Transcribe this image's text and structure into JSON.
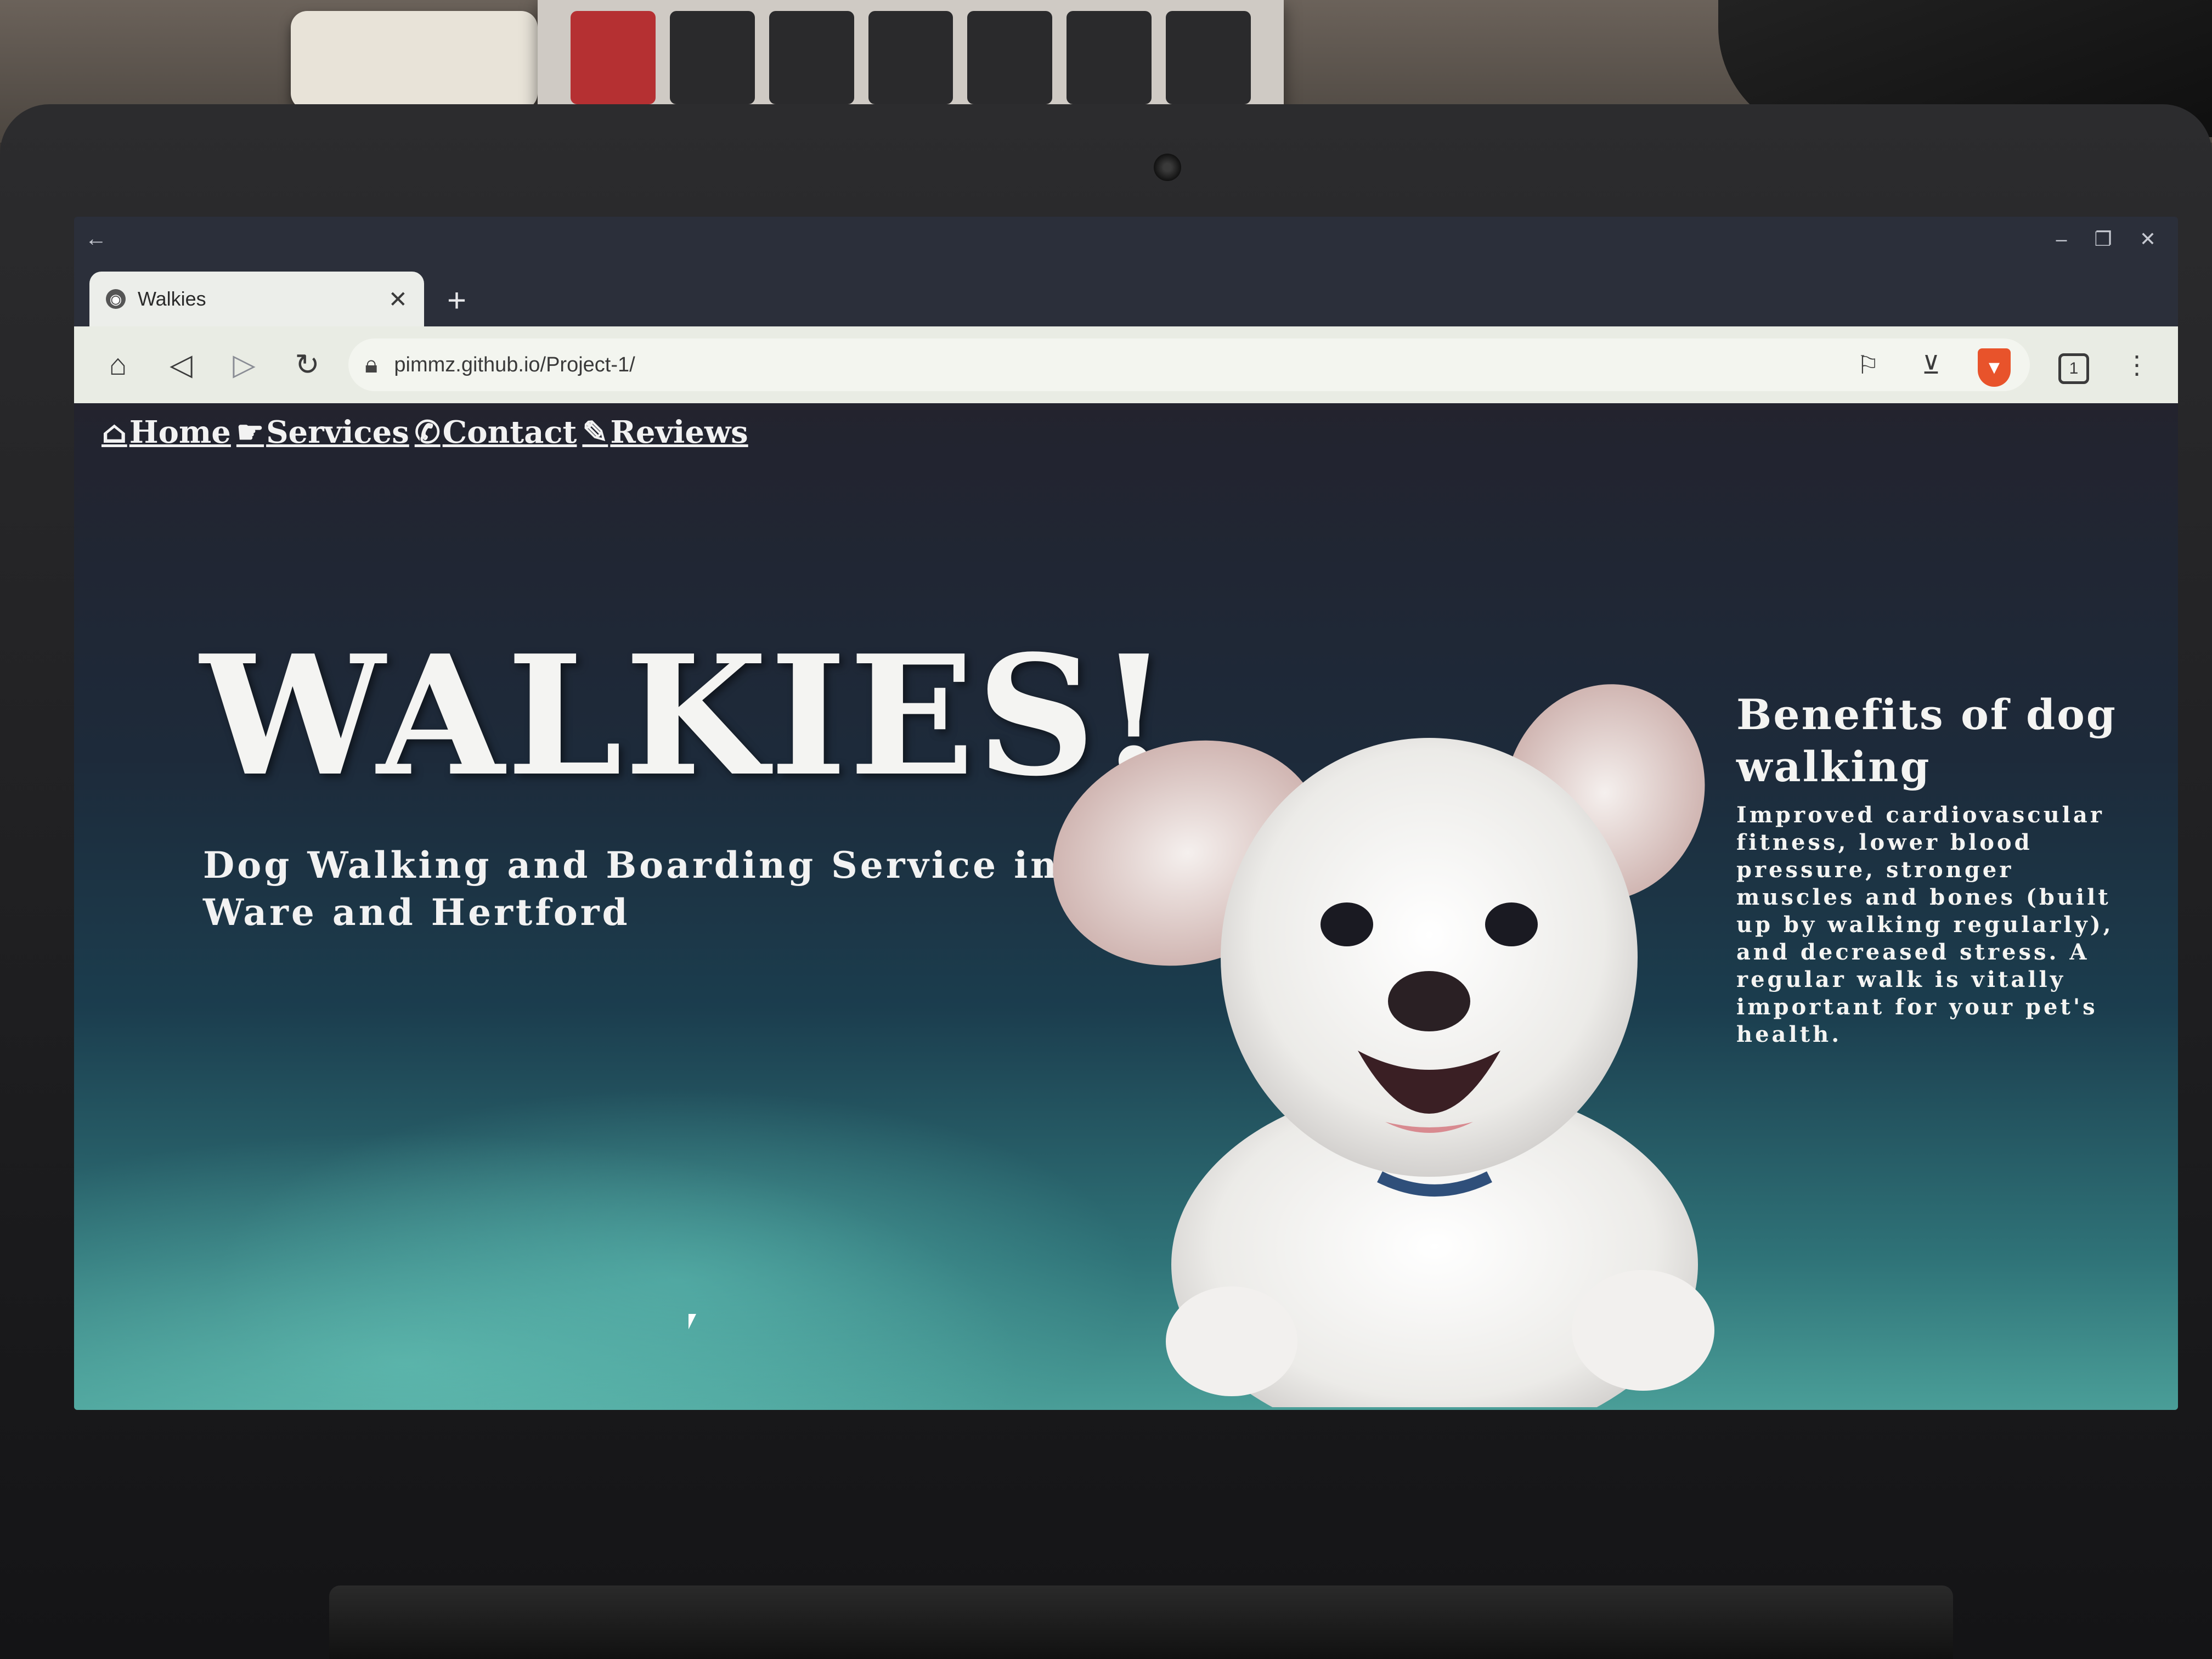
{
  "browser": {
    "tab_title": "Walkies",
    "tab_close": "✕",
    "new_tab": "+",
    "back_arrow": "←",
    "url": "pimmz.github.io/Project-1/",
    "window_controls": [
      "–",
      "❐",
      "✕"
    ],
    "tab_count": "1",
    "icons": [
      "home-icon",
      "back-icon",
      "forward-icon",
      "reload-icon",
      "lock-icon",
      "bookmark-icon",
      "download-icon",
      "brave-shield-icon",
      "tabs-icon",
      "menu-icon"
    ]
  },
  "nav": {
    "items": [
      {
        "label": "Home",
        "icon": "home-icon"
      },
      {
        "label": "Services",
        "icon": "handshake-icon"
      },
      {
        "label": "Contact",
        "icon": "phone-icon"
      },
      {
        "label": "Reviews",
        "icon": "pencil-icon"
      }
    ]
  },
  "hero": {
    "title": "WALKIES!",
    "subtitle": "Dog Walking and Boarding Service in Ware and Hertford"
  },
  "benefits": {
    "title": "Benefits of dog walking",
    "body": "Improved cardiovascular fitness, lower blood pressure, stronger muscles and bones (built up by walking regularly), and decreased stress. A regular walk is vitally important for your pet's health."
  },
  "colors": {
    "chrome_dark": "#2b2f3a",
    "toolbar": "#e9ece4",
    "brave_orange": "#e8532b",
    "page_text": "#f4f4f2"
  }
}
